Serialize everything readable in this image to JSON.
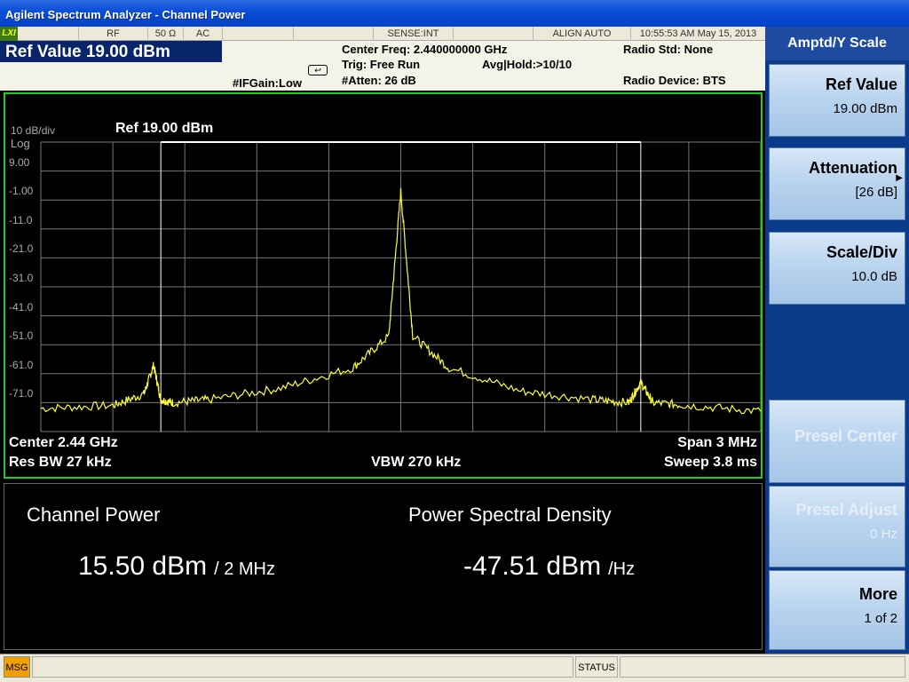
{
  "window": {
    "title": "Agilent Spectrum Analyzer - Channel Power"
  },
  "status_row": {
    "lxi": "LXI",
    "rf": "RF",
    "impedance": "50 Ω",
    "coupling": "AC",
    "sense": "SENSE:INT",
    "align": "ALIGN AUTO",
    "datetime": "10:55:53 AM May 15, 2013"
  },
  "header": {
    "ref_value": "Ref Value  19.00 dBm",
    "ifgain": "#IFGain:Low",
    "center_freq": "Center Freq: 2.440000000 GHz",
    "trig": "Trig: Free Run",
    "avg_hold": "Avg|Hold:>10/10",
    "atten": "#Atten: 26 dB",
    "radio_std": "Radio Std: None",
    "radio_device": "Radio Device: BTS"
  },
  "graph": {
    "scale": "10 dB/div",
    "log": "Log",
    "ref": "Ref  19.00 dBm",
    "y_ticks": [
      "9.00",
      "-1.00",
      "-11.0",
      "-21.0",
      "-31.0",
      "-41.0",
      "-51.0",
      "-61.0",
      "-71.0"
    ],
    "center": "Center  2.44 GHz",
    "res_bw": "Res BW  27 kHz",
    "vbw": "VBW  270 kHz",
    "span": "Span 3 MHz",
    "sweep": "Sweep  3.8 ms",
    "trace_color": "#ffff33",
    "border_color": "#22cc22"
  },
  "chart_data": {
    "type": "line",
    "title": "",
    "xlabel": "",
    "ylabel": "",
    "x_range_mhz": [
      2438.5,
      2441.5
    ],
    "ylim": [
      -81,
      19
    ],
    "y_scale": "log (dB)",
    "grid": true,
    "integration_bw_lines_mhz": [
      2439.0,
      2441.0
    ],
    "series": [
      {
        "x": [
          2438.5,
          2438.8,
          2438.93,
          2438.97,
          2439.0,
          2439.05,
          2439.2,
          2439.5,
          2439.8,
          2439.95,
          2440.0,
          2440.05,
          2440.2,
          2440.5,
          2440.8,
          2440.95,
          2441.0,
          2441.05,
          2441.2,
          2441.5
        ],
        "y": [
          -73,
          -72,
          -68,
          -58,
          -70,
          -71,
          -70,
          -66,
          -59,
          -48,
          2,
          -48,
          -59,
          -67,
          -70,
          -71,
          -64,
          -71,
          -72,
          -74
        ]
      }
    ]
  },
  "results": {
    "channel_power_label": "Channel Power",
    "channel_power_value": "15.50 dBm",
    "channel_power_unit": "/ 2 MHz",
    "psd_label": "Power Spectral Density",
    "psd_value": "-47.51 dBm",
    "psd_unit": "/Hz"
  },
  "softkeys": {
    "menu_title": "Amptd/Y Scale",
    "keys": [
      {
        "label": "Ref Value",
        "value": "19.00 dBm"
      },
      {
        "label": "Attenuation",
        "value": "[26 dB]"
      },
      {
        "label": "Scale/Div",
        "value": "10.0 dB"
      },
      {
        "label": "Presel Center",
        "value": ""
      },
      {
        "label": "Presel Adjust",
        "value": "0 Hz"
      },
      {
        "label": "More",
        "value": "1 of 2"
      }
    ]
  },
  "bottom": {
    "msg": "MSG",
    "status": "STATUS"
  }
}
